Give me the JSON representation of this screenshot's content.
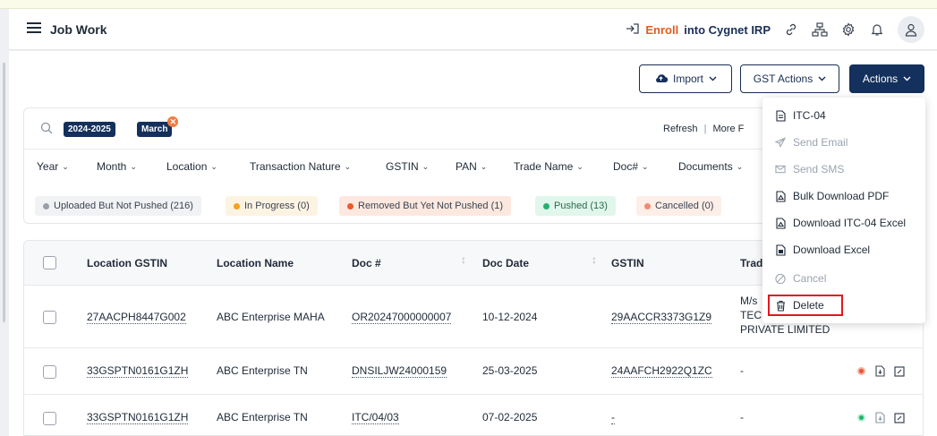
{
  "header": {
    "title": "Job Work",
    "enroll_part1": "Enroll",
    "enroll_part2": "into Cygnet IRP"
  },
  "toolbar": {
    "import_label": "Import",
    "gst_actions_label": "GST Actions",
    "actions_label": "Actions"
  },
  "filters": {
    "year_chip": "2024-2025",
    "month_chip": "March",
    "refresh": "Refresh",
    "separator": "|",
    "more": "More F",
    "columns": [
      "Year",
      "Month",
      "Location",
      "Transaction Nature",
      "GSTIN",
      "PAN",
      "Trade Name",
      "Doc#",
      "Documents"
    ]
  },
  "status_pills": [
    {
      "label": "Uploaded But Not Pushed (216)",
      "color": "#9aa0a8",
      "bg": "#f1f2f4",
      "text": "#3b4452"
    },
    {
      "label": "In Progress (0)",
      "color": "#f2a21a",
      "bg": "#fdf3e2",
      "text": "#3b4452"
    },
    {
      "label": "Removed But Yet Not Pushed (1)",
      "color": "#ec5a2a",
      "bg": "#fde8df",
      "text": "#3b4452"
    },
    {
      "label": "Pushed (13)",
      "color": "#23b26d",
      "bg": "#e1f6ec",
      "text": "#2a6b4d"
    },
    {
      "label": "Cancelled (0)",
      "color": "#f08a72",
      "bg": "#fdeee8",
      "text": "#3b4452"
    }
  ],
  "table": {
    "headers": [
      "Location GSTIN",
      "Location Name",
      "Doc #",
      "Doc Date",
      "GSTIN",
      "Trad"
    ],
    "rows": [
      {
        "location_gstin": "27AACPH8447G002",
        "location_name": "ABC Enterprise MAHA",
        "doc": "OR20247000000007",
        "doc_date": "10-12-2024",
        "gstin": "29AACCR3373G1Z9",
        "trade1": "M/s",
        "trade2": "TECI",
        "trade3": "PRIVATE LIMITED"
      },
      {
        "location_gstin": "33GSPTN0161G1ZH",
        "location_name": "ABC Enterprise TN",
        "doc": "DNSILJW24000159",
        "doc_date": "25-03-2025",
        "gstin": "24AAFCH2922Q1ZC",
        "trade1": "-"
      },
      {
        "location_gstin": "33GSPTN0161G1ZH",
        "location_name": "ABC Enterprise TN",
        "doc": "ITC/04/03",
        "doc_date": "07-02-2025",
        "gstin": "-",
        "trade1": "-"
      }
    ]
  },
  "actions_menu": [
    {
      "label": "ITC-04",
      "icon": "document-icon",
      "enabled": true
    },
    {
      "label": "Send Email",
      "icon": "send-icon",
      "enabled": false
    },
    {
      "label": "Send SMS",
      "icon": "mail-icon",
      "enabled": false
    },
    {
      "label": "Bulk Download PDF",
      "icon": "pdf-icon",
      "enabled": true
    },
    {
      "label": "Download ITC-04 Excel",
      "icon": "pdf-icon",
      "enabled": true
    },
    {
      "label": "Download Excel",
      "icon": "excel-icon",
      "enabled": true
    },
    {
      "label": "Cancel",
      "icon": "cancel-icon",
      "enabled": false
    },
    {
      "label": "Delete",
      "icon": "trash-icon",
      "enabled": true
    }
  ],
  "colors": {
    "brand": "#14305c",
    "accent": "#e25c1f",
    "highlight": "#e3171d"
  }
}
